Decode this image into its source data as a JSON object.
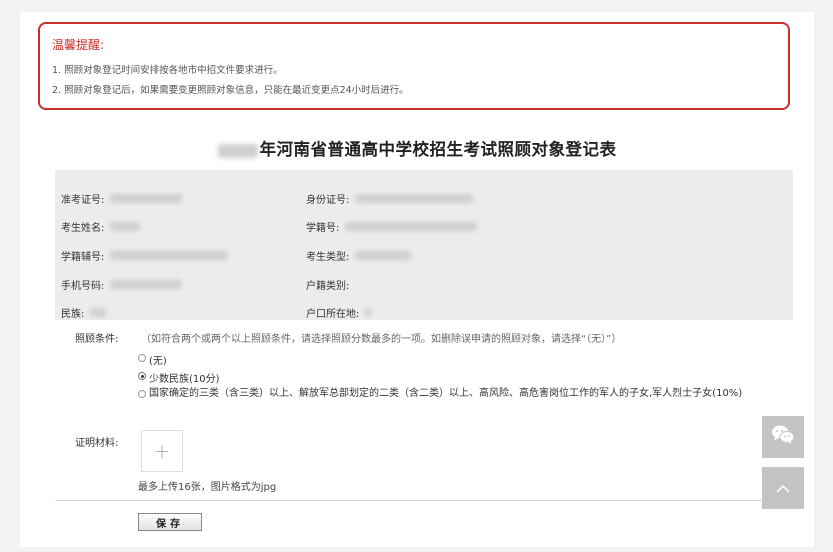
{
  "notice": {
    "title": "温馨提醒:",
    "lines": [
      "1. 照顾对象登记时间安排按各地市中招文件要求进行。",
      "2. 照顾对象登记后，如果需要变更照顾对象信息，只能在最近变更点24小时后进行。"
    ]
  },
  "form": {
    "title": "年河南省普通高中学校招生考试照顾对象登记表"
  },
  "info": {
    "left": [
      {
        "label": "准考证号:"
      },
      {
        "label": "考生姓名:"
      },
      {
        "label": "学籍辅号:"
      },
      {
        "label": "手机号码:"
      },
      {
        "label": "民族:"
      }
    ],
    "right": [
      {
        "label": "身份证号:"
      },
      {
        "label": "学籍号:"
      },
      {
        "label": "考生类型:"
      },
      {
        "label": "户籍类别:"
      },
      {
        "label": "户口所在地:"
      }
    ]
  },
  "conditions": {
    "label": "照顾条件:",
    "hint": "（如符合两个或两个以上照顾条件，请选择照顾分数最多的一项。如删除误申请的照顾对象，请选择“（无）”）",
    "options": [
      {
        "text": "(无)",
        "selected": false
      },
      {
        "text": "少数民族(10分)",
        "selected": true
      },
      {
        "text": "国家确定的三类（含三类）以上、解放军总部划定的二类（含二类）以上、高风险、高危害岗位工作的军人的子女,军人烈士子女(10%)",
        "selected": false
      }
    ]
  },
  "proof": {
    "label": "证明材料:",
    "upload_symbol": "+",
    "hint": "最多上传16张，图片格式为jpg"
  },
  "save_label": "保存",
  "side": {
    "chat_icon": "wechat-icon",
    "top_icon": "chevron-up-icon"
  }
}
